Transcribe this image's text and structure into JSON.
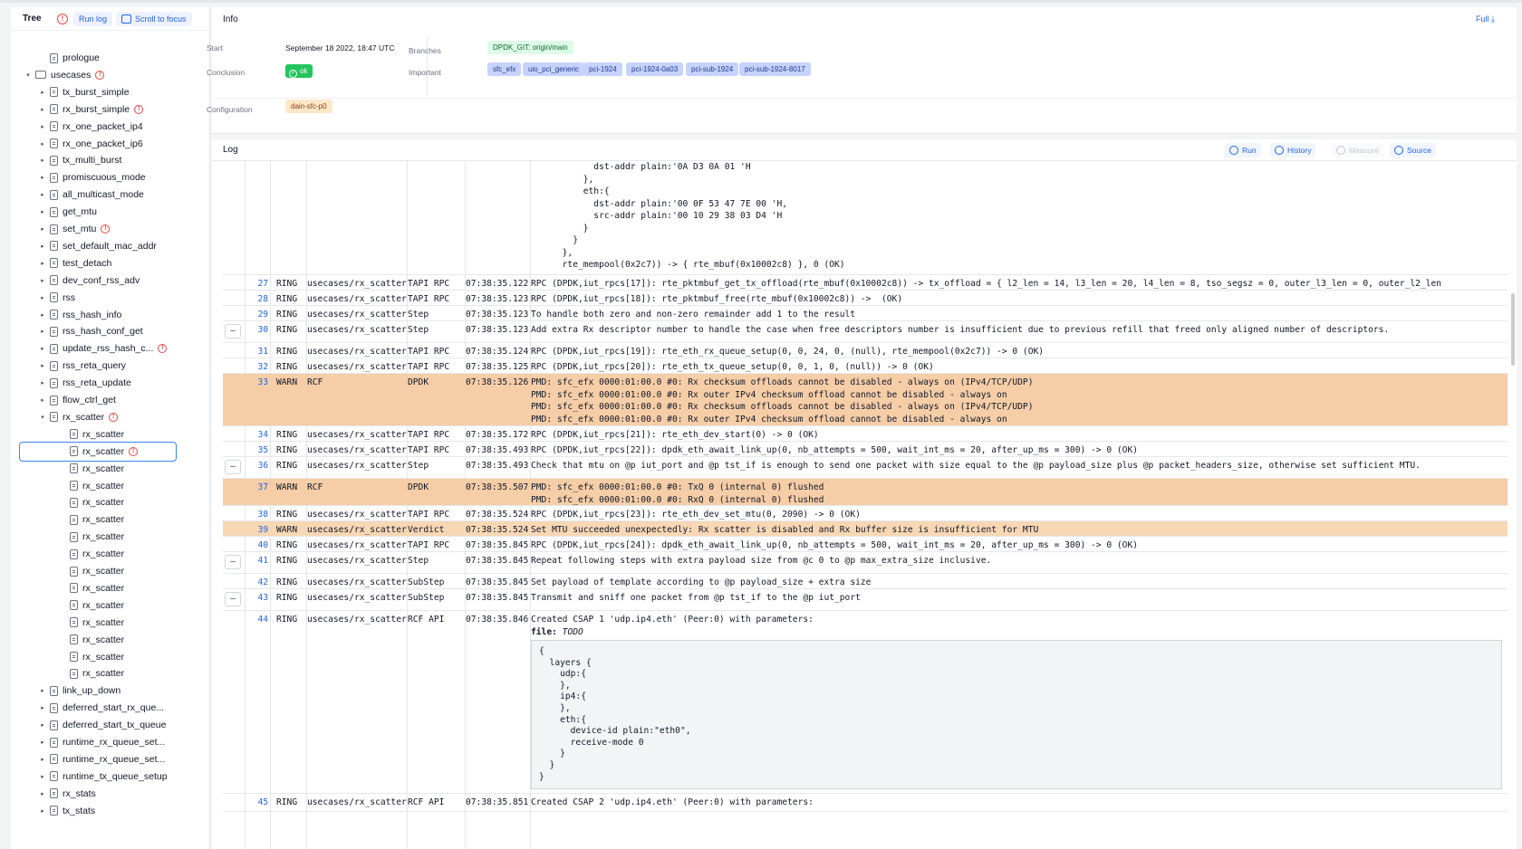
{
  "sidebar": {
    "title": "Tree",
    "run_log": "Run log",
    "scroll_focus": "Scroll to focus",
    "items": [
      {
        "label": "prologue",
        "level": 1,
        "type": "file",
        "chev": "",
        "warn": false
      },
      {
        "label": "usecases",
        "level": 0,
        "type": "dir",
        "chev": "▾",
        "warn": true
      },
      {
        "label": "tx_burst_simple",
        "level": 1,
        "type": "file",
        "chev": "▸",
        "warn": false
      },
      {
        "label": "rx_burst_simple",
        "level": 1,
        "type": "file",
        "chev": "▸",
        "warn": true
      },
      {
        "label": "rx_one_packet_ip4",
        "level": 1,
        "type": "file",
        "chev": "▸",
        "warn": false
      },
      {
        "label": "rx_one_packet_ip6",
        "level": 1,
        "type": "file",
        "chev": "▸",
        "warn": false
      },
      {
        "label": "tx_multi_burst",
        "level": 1,
        "type": "file",
        "chev": "▸",
        "warn": false
      },
      {
        "label": "promiscuous_mode",
        "level": 1,
        "type": "file",
        "chev": "▸",
        "warn": false
      },
      {
        "label": "all_multicast_mode",
        "level": 1,
        "type": "file",
        "chev": "▸",
        "warn": false
      },
      {
        "label": "get_mtu",
        "level": 1,
        "type": "file",
        "chev": "▸",
        "warn": false
      },
      {
        "label": "set_mtu",
        "level": 1,
        "type": "file",
        "chev": "▸",
        "warn": true
      },
      {
        "label": "set_default_mac_addr",
        "level": 1,
        "type": "file",
        "chev": "▸",
        "warn": false
      },
      {
        "label": "test_detach",
        "level": 1,
        "type": "file",
        "chev": "▸",
        "warn": false
      },
      {
        "label": "dev_conf_rss_adv",
        "level": 1,
        "type": "file",
        "chev": "▸",
        "warn": false
      },
      {
        "label": "rss",
        "level": 1,
        "type": "file",
        "chev": "▸",
        "warn": false
      },
      {
        "label": "rss_hash_info",
        "level": 1,
        "type": "file",
        "chev": "▸",
        "warn": false
      },
      {
        "label": "rss_hash_conf_get",
        "level": 1,
        "type": "file",
        "chev": "▸",
        "warn": false
      },
      {
        "label": "update_rss_hash_c...",
        "level": 1,
        "type": "file",
        "chev": "▸",
        "warn": true
      },
      {
        "label": "rss_reta_query",
        "level": 1,
        "type": "file",
        "chev": "▸",
        "warn": false
      },
      {
        "label": "rss_reta_update",
        "level": 1,
        "type": "file",
        "chev": "▸",
        "warn": false
      },
      {
        "label": "flow_ctrl_get",
        "level": 1,
        "type": "file",
        "chev": "▸",
        "warn": false
      },
      {
        "label": "rx_scatter",
        "level": 1,
        "type": "file",
        "chev": "▾",
        "warn": true
      },
      {
        "label": "rx_scatter",
        "level": 2,
        "type": "file",
        "chev": "",
        "warn": false
      },
      {
        "label": "rx_scatter",
        "level": 2,
        "type": "file",
        "chev": "",
        "warn": true,
        "selected": true
      },
      {
        "label": "rx_scatter",
        "level": 2,
        "type": "file",
        "chev": "",
        "warn": false
      },
      {
        "label": "rx_scatter",
        "level": 2,
        "type": "file",
        "chev": "",
        "warn": false
      },
      {
        "label": "rx_scatter",
        "level": 2,
        "type": "file",
        "chev": "",
        "warn": false
      },
      {
        "label": "rx_scatter",
        "level": 2,
        "type": "file",
        "chev": "",
        "warn": false
      },
      {
        "label": "rx_scatter",
        "level": 2,
        "type": "file",
        "chev": "",
        "warn": false
      },
      {
        "label": "rx_scatter",
        "level": 2,
        "type": "file",
        "chev": "",
        "warn": false
      },
      {
        "label": "rx_scatter",
        "level": 2,
        "type": "file",
        "chev": "",
        "warn": false
      },
      {
        "label": "rx_scatter",
        "level": 2,
        "type": "file",
        "chev": "",
        "warn": false
      },
      {
        "label": "rx_scatter",
        "level": 2,
        "type": "file",
        "chev": "",
        "warn": false
      },
      {
        "label": "rx_scatter",
        "level": 2,
        "type": "file",
        "chev": "",
        "warn": false
      },
      {
        "label": "rx_scatter",
        "level": 2,
        "type": "file",
        "chev": "",
        "warn": false
      },
      {
        "label": "rx_scatter",
        "level": 2,
        "type": "file",
        "chev": "",
        "warn": false
      },
      {
        "label": "rx_scatter",
        "level": 2,
        "type": "file",
        "chev": "",
        "warn": false
      },
      {
        "label": "link_up_down",
        "level": 1,
        "type": "file",
        "chev": "▸",
        "warn": false
      },
      {
        "label": "deferred_start_rx_que...",
        "level": 1,
        "type": "file",
        "chev": "▸",
        "warn": false
      },
      {
        "label": "deferred_start_tx_queue",
        "level": 1,
        "type": "file",
        "chev": "▸",
        "warn": false
      },
      {
        "label": "runtime_rx_queue_set...",
        "level": 1,
        "type": "file",
        "chev": "▸",
        "warn": false
      },
      {
        "label": "runtime_rx_queue_set...",
        "level": 1,
        "type": "file",
        "chev": "▸",
        "warn": false
      },
      {
        "label": "runtime_tx_queue_setup",
        "level": 1,
        "type": "file",
        "chev": "▸",
        "warn": false
      },
      {
        "label": "rx_stats",
        "level": 1,
        "type": "file",
        "chev": "▸",
        "warn": false
      },
      {
        "label": "tx_stats",
        "level": 1,
        "type": "file",
        "chev": "▸",
        "warn": false
      }
    ]
  },
  "info": {
    "title": "Info",
    "full": "Full",
    "start_label": "Start",
    "start_value": "September 18 2022, 18:47 UTC",
    "conclusion_label": "Conclusion",
    "conclusion_value": "ok",
    "branches_label": "Branches",
    "branch_tag": "DPDK_GIT: origin/main",
    "important_label": "Important",
    "important_tags": [
      "sfc_efx",
      "uio_pci_generic",
      "pci-1924",
      "pci-1924-0a03",
      "pci-sub-1924",
      "pci-sub-1924-8017"
    ],
    "configuration_label": "Configuration",
    "configuration_value": "dain-sfc-p0"
  },
  "log": {
    "title": "Log",
    "buttons": {
      "run": "Run",
      "history": "History",
      "measure": "Measure",
      "source": "Source"
    },
    "top_fragment": "            dst-addr plain:'0A D3 0A 01 'H\n          },\n          eth:{\n            dst-addr plain:'00 0F 53 47 7E 00 'H,\n            src-addr plain:'00 10 29 38 03 D4 'H\n          }\n        }\n      },\n      rte_mempool(0x2c7)) -> { rte_mbuf(0x10002c8) }, 0 (OK)",
    "rows": [
      {
        "num": "27",
        "level": "RING",
        "entity": "usecases/rx_scatter",
        "user": "TAPI RPC",
        "ts": "07:38:35.122",
        "msg": "RPC (DPDK,iut_rpcs[17]): rte_pktmbuf_get_tx_offload(rte_mbuf(0x10002c8)) -> tx_offload = { l2_len = 14, l3_len = 20, l4_len = 8, tso_segsz = 0, outer_l3_len = 0, outer_l2_len"
      },
      {
        "num": "28",
        "level": "RING",
        "entity": "usecases/rx_scatter",
        "user": "TAPI RPC",
        "ts": "07:38:35.123",
        "msg": "RPC (DPDK,iut_rpcs[18]): rte_pktmbuf_free(rte_mbuf(0x10002c8)) ->  (OK)"
      },
      {
        "num": "29",
        "level": "RING",
        "entity": "usecases/rx_scatter",
        "user": "Step",
        "ts": "07:38:35.123",
        "msg": "To handle both zero and non-zero remainder add 1 to the result"
      },
      {
        "num": "30",
        "level": "RING",
        "entity": "usecases/rx_scatter",
        "user": "Step",
        "ts": "07:38:35.123",
        "msg": "Add extra Rx descriptor number to handle the case when free descriptors number is insufficient due to previous refill that freed only aligned number of descriptors.",
        "minus": "–"
      },
      {
        "num": "31",
        "level": "RING",
        "entity": "usecases/rx_scatter",
        "user": "TAPI RPC",
        "ts": "07:38:35.124",
        "msg": "RPC (DPDK,iut_rpcs[19]): rte_eth_rx_queue_setup(0, 0, 24, 0, (null), rte_mempool(0x2c7)) -> 0 (OK)"
      },
      {
        "num": "32",
        "level": "RING",
        "entity": "usecases/rx_scatter",
        "user": "TAPI RPC",
        "ts": "07:38:35.125",
        "msg": "RPC (DPDK,iut_rpcs[20]): rte_eth_tx_queue_setup(0, 0, 1, 0, (null)) -> 0 (OK)"
      },
      {
        "num": "33",
        "level": "WARN",
        "entity": "RCF",
        "user": "DPDK",
        "ts": "07:38:35.126",
        "msg": "PMD: sfc_efx 0000:01:00.0 #0: Rx checksum offloads cannot be disabled - always on (IPv4/TCP/UDP)\nPMD: sfc_efx 0000:01:00.0 #0: Rx outer IPv4 checksum offload cannot be disabled - always on\nPMD: sfc_efx 0000:01:00.0 #0: Rx checksum offloads cannot be disabled - always on (IPv4/TCP/UDP)\nPMD: sfc_efx 0000:01:00.0 #0: Rx outer IPv4 checksum offload cannot be disabled - always on"
      },
      {
        "num": "34",
        "level": "RING",
        "entity": "usecases/rx_scatter",
        "user": "TAPI RPC",
        "ts": "07:38:35.172",
        "msg": "RPC (DPDK,iut_rpcs[21]): rte_eth_dev_start(0) -> 0 (OK)"
      },
      {
        "num": "35",
        "level": "RING",
        "entity": "usecases/rx_scatter",
        "user": "TAPI RPC",
        "ts": "07:38:35.493",
        "msg": "RPC (DPDK,iut_rpcs[22]): dpdk_eth_await_link_up(0, nb_attempts = 500, wait_int_ms = 20, after_up_ms = 300) -> 0 (OK)"
      },
      {
        "num": "36",
        "level": "RING",
        "entity": "usecases/rx_scatter",
        "user": "Step",
        "ts": "07:38:35.493",
        "msg": "Check that mtu on @p iut_port and @p tst_if is enough to send one packet with size equal to the @p payload_size plus @p packet_headers_size, otherwise set sufficient MTU.",
        "minus": "–"
      },
      {
        "num": "37",
        "level": "WARN",
        "entity": "RCF",
        "user": "DPDK",
        "ts": "07:38:35.507",
        "msg": "PMD: sfc_efx 0000:01:00.0 #0: TxQ 0 (internal 0) flushed\nPMD: sfc_efx 0000:01:00.0 #0: RxQ 0 (internal 0) flushed"
      },
      {
        "num": "38",
        "level": "RING",
        "entity": "usecases/rx_scatter",
        "user": "TAPI RPC",
        "ts": "07:38:35.524",
        "msg": "RPC (DPDK,iut_rpcs[23]): rte_eth_dev_set_mtu(0, 2090) -> 0 (OK)"
      },
      {
        "num": "39",
        "level": "WARN",
        "entity": "usecases/rx_scatter",
        "user": "Verdict",
        "ts": "07:38:35.524",
        "msg": "Set MTU succeeded unexpectedly: Rx scatter is disabled and Rx buffer size is insufficient for MTU"
      },
      {
        "num": "40",
        "level": "RING",
        "entity": "usecases/rx_scatter",
        "user": "TAPI RPC",
        "ts": "07:38:35.845",
        "msg": "RPC (DPDK,iut_rpcs[24]): dpdk_eth_await_link_up(0, nb_attempts = 500, wait_int_ms = 20, after_up_ms = 300) -> 0 (OK)"
      },
      {
        "num": "41",
        "level": "RING",
        "entity": "usecases/rx_scatter",
        "user": "Step",
        "ts": "07:38:35.845",
        "msg": "Repeat following steps with extra payload size from @c 0 to @p max_extra_size inclusive.",
        "minus": "–"
      },
      {
        "num": "42",
        "level": "RING",
        "entity": "usecases/rx_scatter",
        "user": "SubStep",
        "ts": "07:38:35.845",
        "msg": "Set payload of template according to @p payload_size + extra size"
      },
      {
        "num": "43",
        "level": "RING",
        "entity": "usecases/rx_scatter",
        "user": "SubStep",
        "ts": "07:38:35.845",
        "msg": "Transmit and sniff one packet from @p tst_if to the @p iut_port",
        "minus": "–"
      },
      {
        "num": "44",
        "level": "RING",
        "entity": "usecases/rx_scatter",
        "user": "RCF API",
        "ts": "07:38:35.846",
        "msg": "Created CSAP 1 'udp.ip4.eth' (Peer:0) with parameters:"
      },
      {
        "num": "45",
        "level": "RING",
        "entity": "usecases/rx_scatter",
        "user": "RCF API",
        "ts": "07:38:35.851",
        "msg": "Created CSAP 2 'udp.ip4.eth' (Peer:0) with parameters:"
      }
    ],
    "file_label": "file:",
    "file_value": "TODO",
    "code": "{\n  layers {\n    udp:{\n    },\n    ip4:{\n    },\n    eth:{\n      device-id plain:\"eth0\",\n      receive-mode 0\n    }\n  }\n}"
  }
}
